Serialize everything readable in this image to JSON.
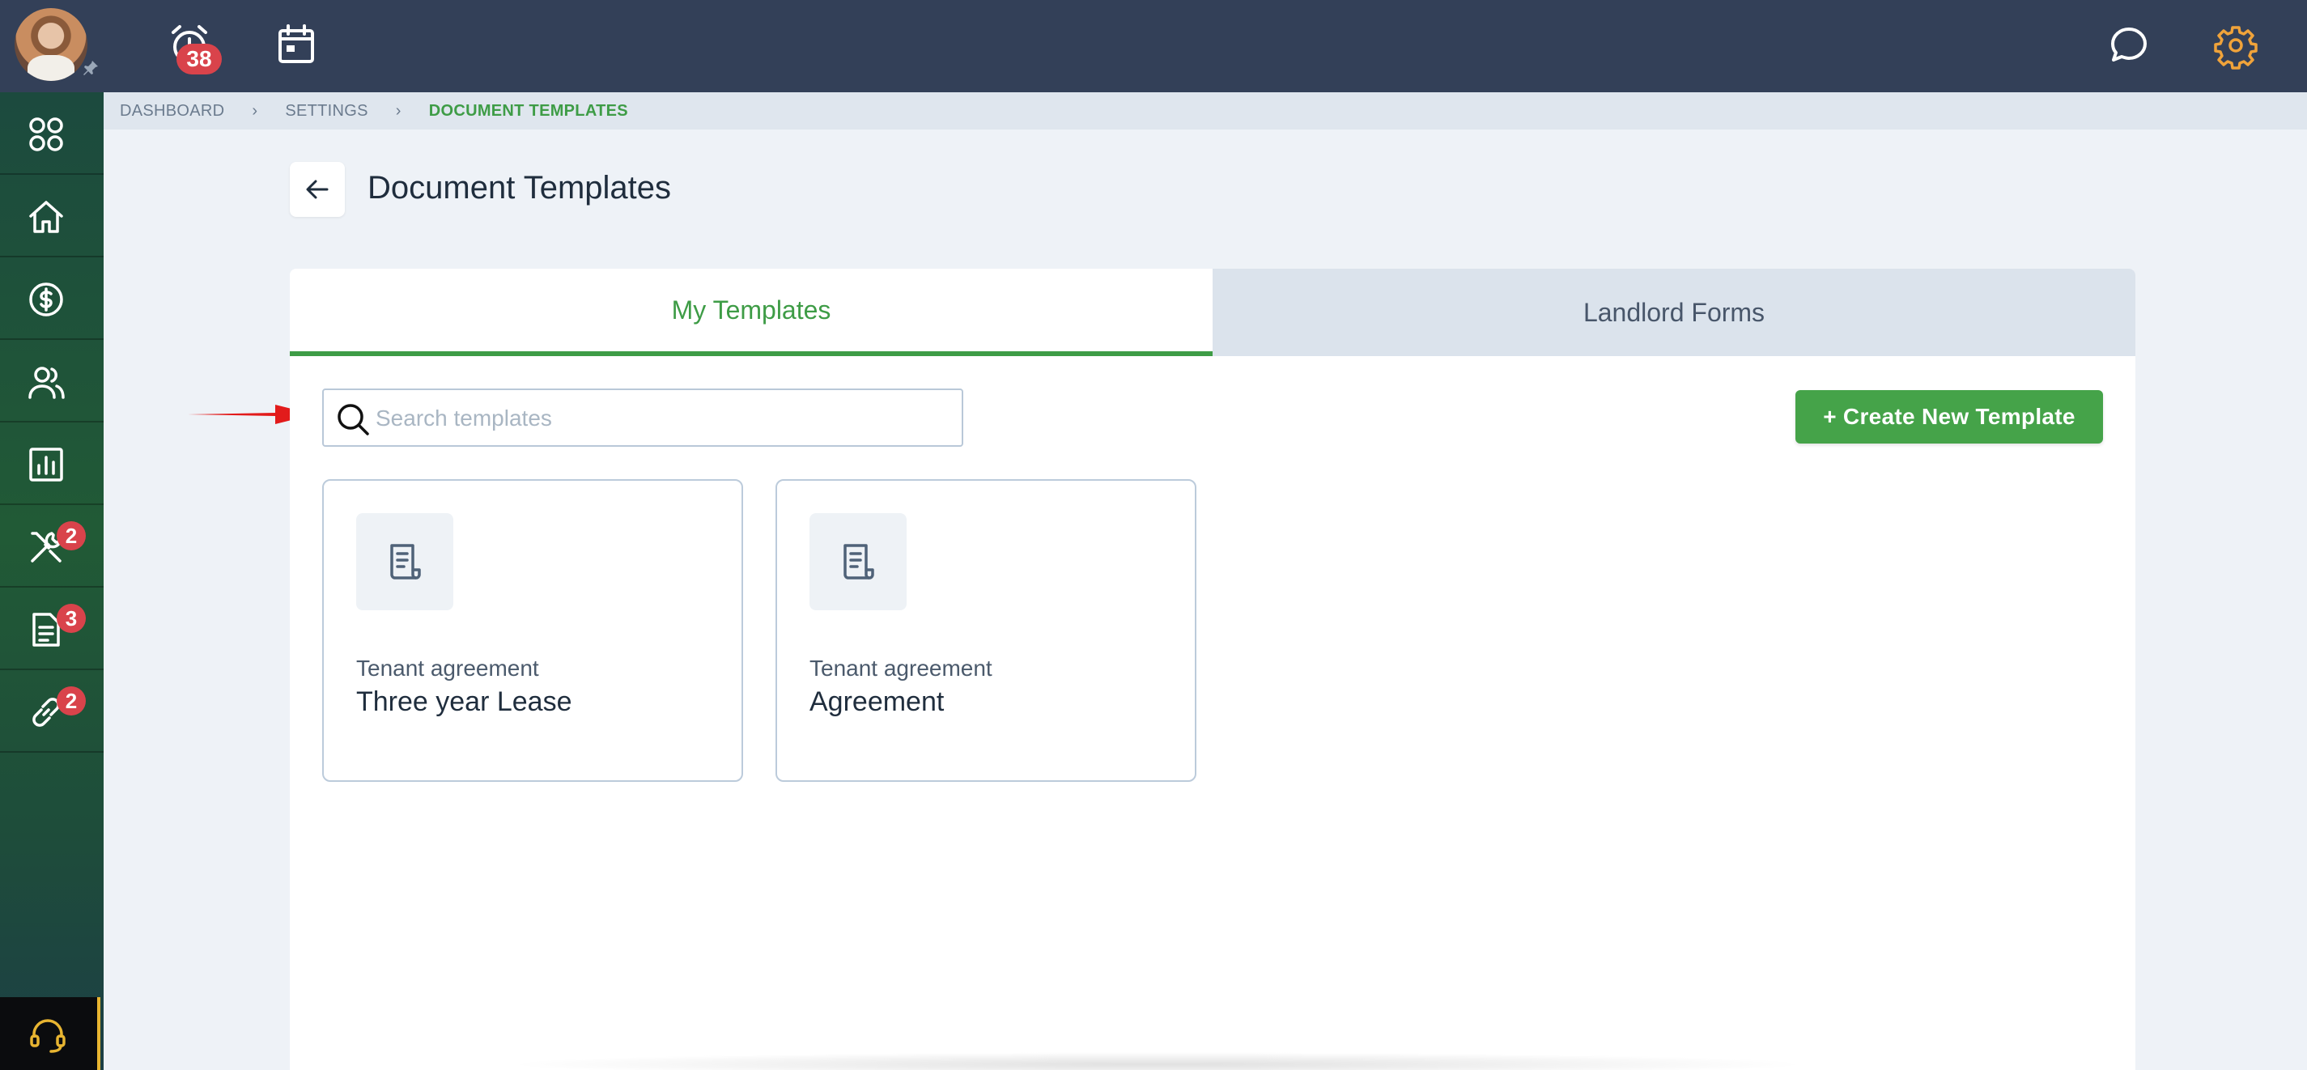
{
  "topbar": {
    "notifications_count": "38"
  },
  "sidebar": {
    "items": [
      {
        "icon": "apps-icon",
        "badge": ""
      },
      {
        "icon": "home-icon",
        "badge": ""
      },
      {
        "icon": "dollar-icon",
        "badge": ""
      },
      {
        "icon": "people-icon",
        "badge": ""
      },
      {
        "icon": "reports-icon",
        "badge": ""
      },
      {
        "icon": "tools-icon",
        "badge": "2"
      },
      {
        "icon": "document-icon",
        "badge": "3"
      },
      {
        "icon": "link-icon",
        "badge": "2"
      }
    ]
  },
  "breadcrumb": {
    "items": [
      "DASHBOARD",
      "SETTINGS",
      "DOCUMENT TEMPLATES"
    ]
  },
  "page": {
    "title": "Document Templates"
  },
  "tabs": [
    {
      "label": "My Templates",
      "active": true
    },
    {
      "label": "Landlord Forms",
      "active": false
    }
  ],
  "search": {
    "value": "",
    "placeholder": "Search templates"
  },
  "actions": {
    "create_label": "+ Create New Template"
  },
  "templates": [
    {
      "category": "Tenant agreement",
      "name": "Three year Lease"
    },
    {
      "category": "Tenant agreement",
      "name": "Agreement"
    }
  ],
  "colors": {
    "topbar": "#334058",
    "accent_green": "#45a349",
    "badge_red": "#d9434b",
    "gear_orange": "#f0a33a"
  }
}
